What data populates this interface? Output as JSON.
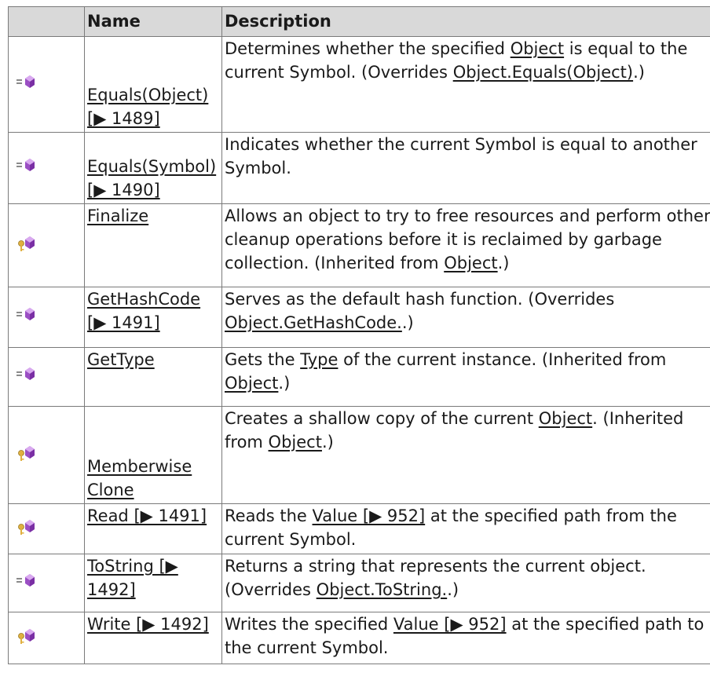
{
  "header": {
    "name": "Name",
    "description": "Description"
  },
  "rows": [
    {
      "icon": "public-method-icon",
      "name": "Equals(Object) [▶ 1489]",
      "description": [
        "Determines whether the specified ",
        {
          "link": "Object"
        },
        " is equal to the current Symbol. (Overrides ",
        {
          "link": "Object.Equals(Object)"
        },
        ".)"
      ]
    },
    {
      "icon": "public-method-icon",
      "name": "Equals(Symbol) [▶ 1490]",
      "description": [
        "Indicates whether the current Symbol is equal to another Symbol."
      ]
    },
    {
      "icon": "protected-method-icon",
      "name": "Finalize",
      "description": [
        "Allows an object to try to free resources and perform other cleanup operations before it is reclaimed by garbage collection. (Inherited from ",
        {
          "link": "Object"
        },
        ".)"
      ]
    },
    {
      "icon": "public-method-icon",
      "name": "GetHashCode [▶ 1491]",
      "description": [
        "Serves as the default hash function. (Overrides ",
        {
          "link": "Object.GetHashCode."
        },
        ".)"
      ]
    },
    {
      "icon": "public-method-icon",
      "name": "GetType",
      "description": [
        "Gets the ",
        {
          "link": "Type"
        },
        " of the current instance. (Inherited from ",
        {
          "link": "Object"
        },
        ".)"
      ]
    },
    {
      "icon": "protected-method-icon",
      "name": "Memberwise Clone",
      "description": [
        "Creates a shallow copy of the current ",
        {
          "link": "Object"
        },
        ". (Inherited from ",
        {
          "link": "Object"
        },
        ".)"
      ]
    },
    {
      "icon": "protected-method-icon",
      "name": "Read [▶ 1491]",
      "description": [
        "Reads the ",
        {
          "link": "Value [▶ 952]"
        },
        " at the specified path from the current Symbol."
      ]
    },
    {
      "icon": "public-method-icon",
      "name": "ToString [▶ 1492]",
      "description": [
        "Returns a string that represents the current object. (Overrides ",
        {
          "link": "Object.ToString."
        },
        ".)"
      ]
    },
    {
      "icon": "protected-method-icon",
      "name": "Write [▶ 1492]",
      "description": [
        "Writes the specified ",
        {
          "link": "Value [▶ 952]"
        },
        " at the specified path to the current Symbol."
      ]
    }
  ],
  "colors": {
    "header_bg": "#d9d9d9",
    "border": "#7a7a7a",
    "method_purple": "#9b4fc4",
    "key_yellow": "#e0b040"
  }
}
